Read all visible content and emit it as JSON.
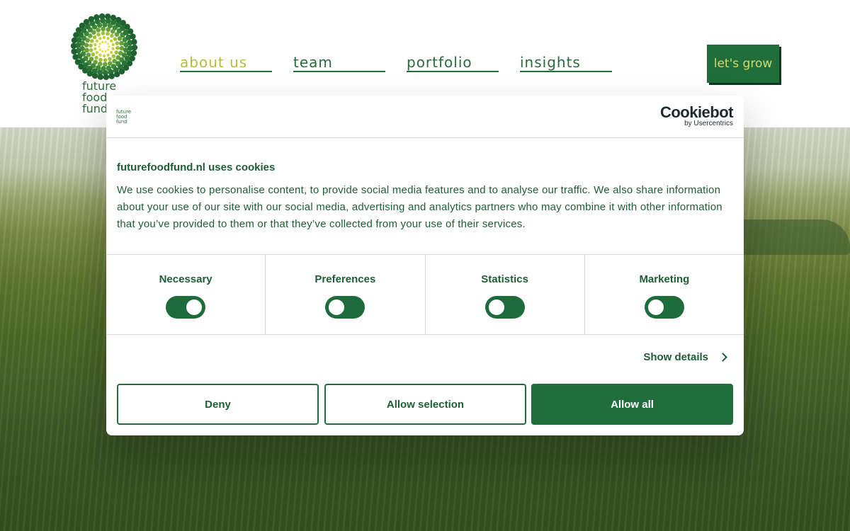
{
  "header": {
    "logo_lines": [
      "future",
      "food",
      "fund"
    ],
    "nav": [
      {
        "label": "about us"
      },
      {
        "label": "team"
      },
      {
        "label": "portfolio"
      },
      {
        "label": "insights"
      }
    ],
    "cta_label": "let's grow"
  },
  "cookie_dialog": {
    "logo_lines": [
      "future",
      "food",
      "fund"
    ],
    "brand_name": "Cookiebot",
    "brand_sub": "by Usercentrics",
    "title": "futurefoodfund.nl uses cookies",
    "body": "We use cookies to personalise content, to provide social media features and to analyse our traffic. We also share information about your use of our site with our social media, advertising and analytics partners who may combine it with other information that you’ve provided to them or that they’ve collected from your use of their services.",
    "categories": [
      {
        "label": "Necessary",
        "enabled": true
      },
      {
        "label": "Preferences",
        "enabled": false
      },
      {
        "label": "Statistics",
        "enabled": false
      },
      {
        "label": "Marketing",
        "enabled": false
      }
    ],
    "show_details": "Show details",
    "buttons": {
      "deny": "Deny",
      "allow_selection": "Allow selection",
      "allow_all": "Allow all"
    }
  },
  "colors": {
    "brand_green": "#1f6e3c",
    "accent_yellow": "#d9d76a",
    "text_green": "#1f5e35"
  }
}
